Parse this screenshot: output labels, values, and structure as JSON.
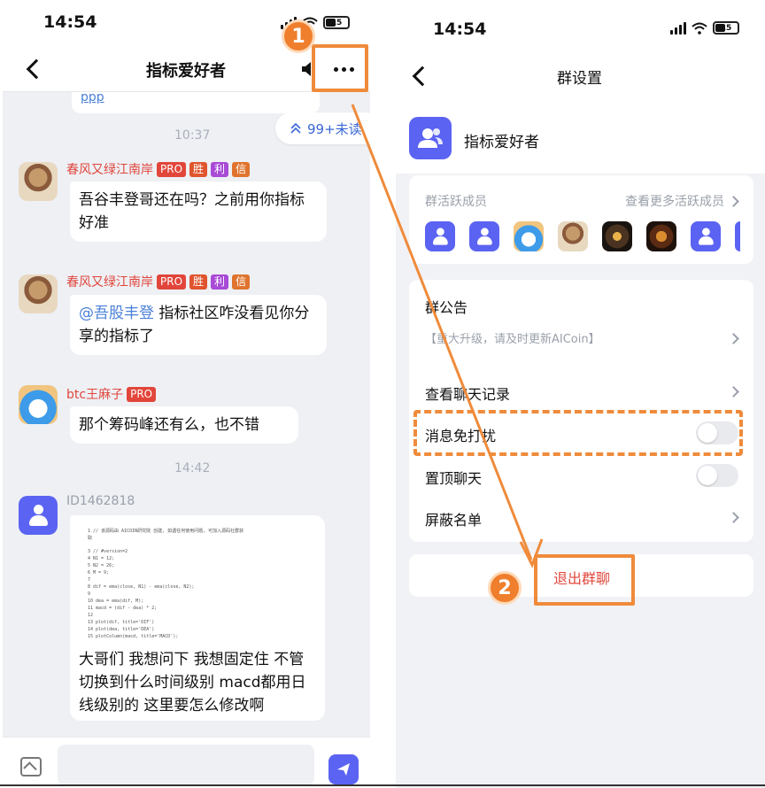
{
  "left": {
    "status_time": "14:54",
    "battery": "15",
    "title": "指标爱好者",
    "prev_link": "ppp",
    "unread_label": "99+未读",
    "messages": [
      {
        "time": "10:37",
        "user": "春风又绿江南岸",
        "badges": [
          "PRO",
          "胜",
          "利",
          "信"
        ],
        "text": "吾谷丰登哥还在吗？之前用你指标好准"
      },
      {
        "user": "春风又绿江南岸",
        "badges": [
          "PRO",
          "胜",
          "利",
          "信"
        ],
        "mention": "@吾股丰登",
        "text": " 指标社区咋没看见你分享的指标了"
      },
      {
        "user": "btc王麻子",
        "badges": [
          "PRO"
        ],
        "text": "那个筹码峰还有么，也不错"
      },
      {
        "time": "14:42",
        "user": "ID1462818",
        "text": "大哥们 我想问下 我想固定住 不管切换到什么时间级别 macd都用日线级别的 这里要怎么修改啊"
      }
    ],
    "code_lines": [
      "1  // 该源码由 AICOIN研究院 创建, 如遇任何使用问题, 可加入源码社群获",
      "   取",
      "3  // #version=2",
      "4  N1 = 12;",
      "5  N2 = 26;",
      "6  M = 9;",
      "7",
      "8  dif = ema(close, N1) - ema(close, N2);",
      "9",
      "10 dea = ema(dif, M);",
      "11 macd = (dif - dea) * 2;",
      "12",
      "13 plot(dif, title='DIF')",
      "14 plot(dea, title='DEA')",
      "15 plotColumn(macd, title='MACD');"
    ]
  },
  "right": {
    "status_time": "14:54",
    "battery": "15",
    "title": "群设置",
    "group_name": "指标爱好者",
    "active_members_label": "群活跃成员",
    "more_members_link": "查看更多活跃成员",
    "announcement_title": "群公告",
    "announcement_text": "【重大升级，请及时更新AICoin】",
    "chat_history": "查看聊天记录",
    "mute_label": "消息免打扰",
    "pin_label": "置顶聊天",
    "block_list": "屏蔽名单",
    "exit_label": "退出群聊"
  },
  "annotations": {
    "step1": "1",
    "step2": "2",
    "accent_color": "#ef8b3b"
  }
}
